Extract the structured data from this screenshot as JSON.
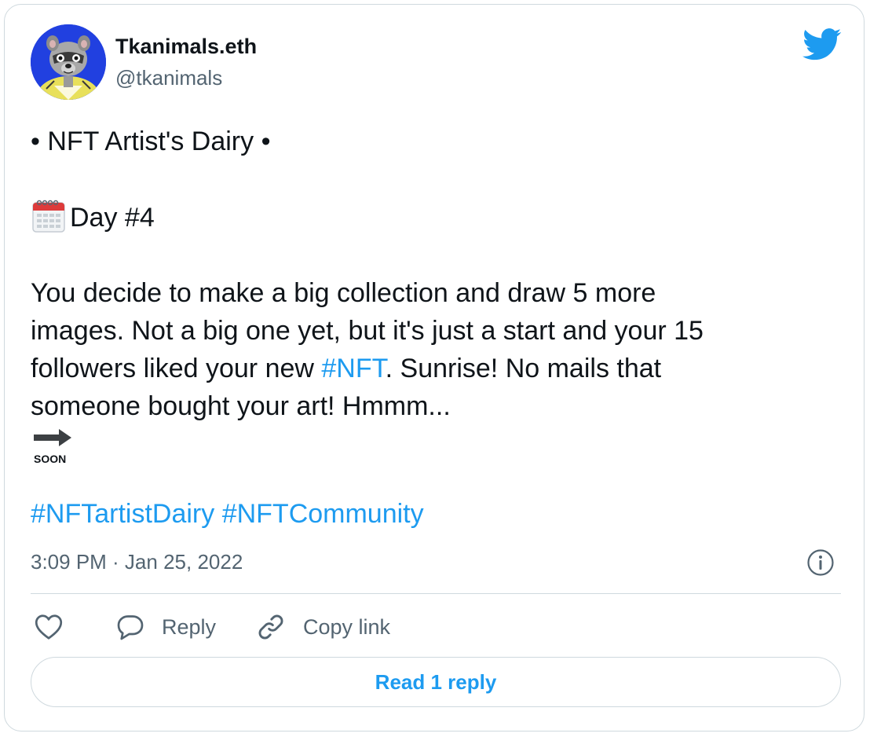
{
  "author": {
    "name": "Tkanimals.eth",
    "handle": "@tkanimals",
    "avatar": "avatar-raccoon-illustration"
  },
  "brand": {
    "icon": "twitter-bird-icon",
    "color": "#1d9bf0"
  },
  "tweet": {
    "title_line": "• NFT Artist's Dairy •",
    "day_icon": "calendar-icon",
    "day_line": "Day #4",
    "body": {
      "line1": "You decide to make a big collection and draw 5 more",
      "line2": "images. Not a big one yet, but it's just a start and your 15",
      "line3_before": "followers liked your new ",
      "line3_hashtag": "#NFT",
      "line3_after": ". Sunrise! No mails that",
      "line4": "someone bought your art! Hmmm..."
    },
    "soon_icon": "soon-arrow-icon",
    "soon_label": "SOON",
    "hashtags": [
      "#NFTartistDairy",
      "#NFTCommunity"
    ]
  },
  "meta": {
    "timestamp": "3:09 PM · Jan 25, 2022",
    "info_icon": "info-icon"
  },
  "actions": {
    "like_icon": "heart-icon",
    "reply_label": "Reply",
    "reply_icon": "reply-bubble-icon",
    "copy_label": "Copy link",
    "copy_icon": "link-icon"
  },
  "read_replies_label": "Read 1 reply",
  "colors": {
    "text_primary": "#0f1419",
    "text_secondary": "#536471",
    "link": "#1d9bf0",
    "border": "#cfd9de"
  }
}
